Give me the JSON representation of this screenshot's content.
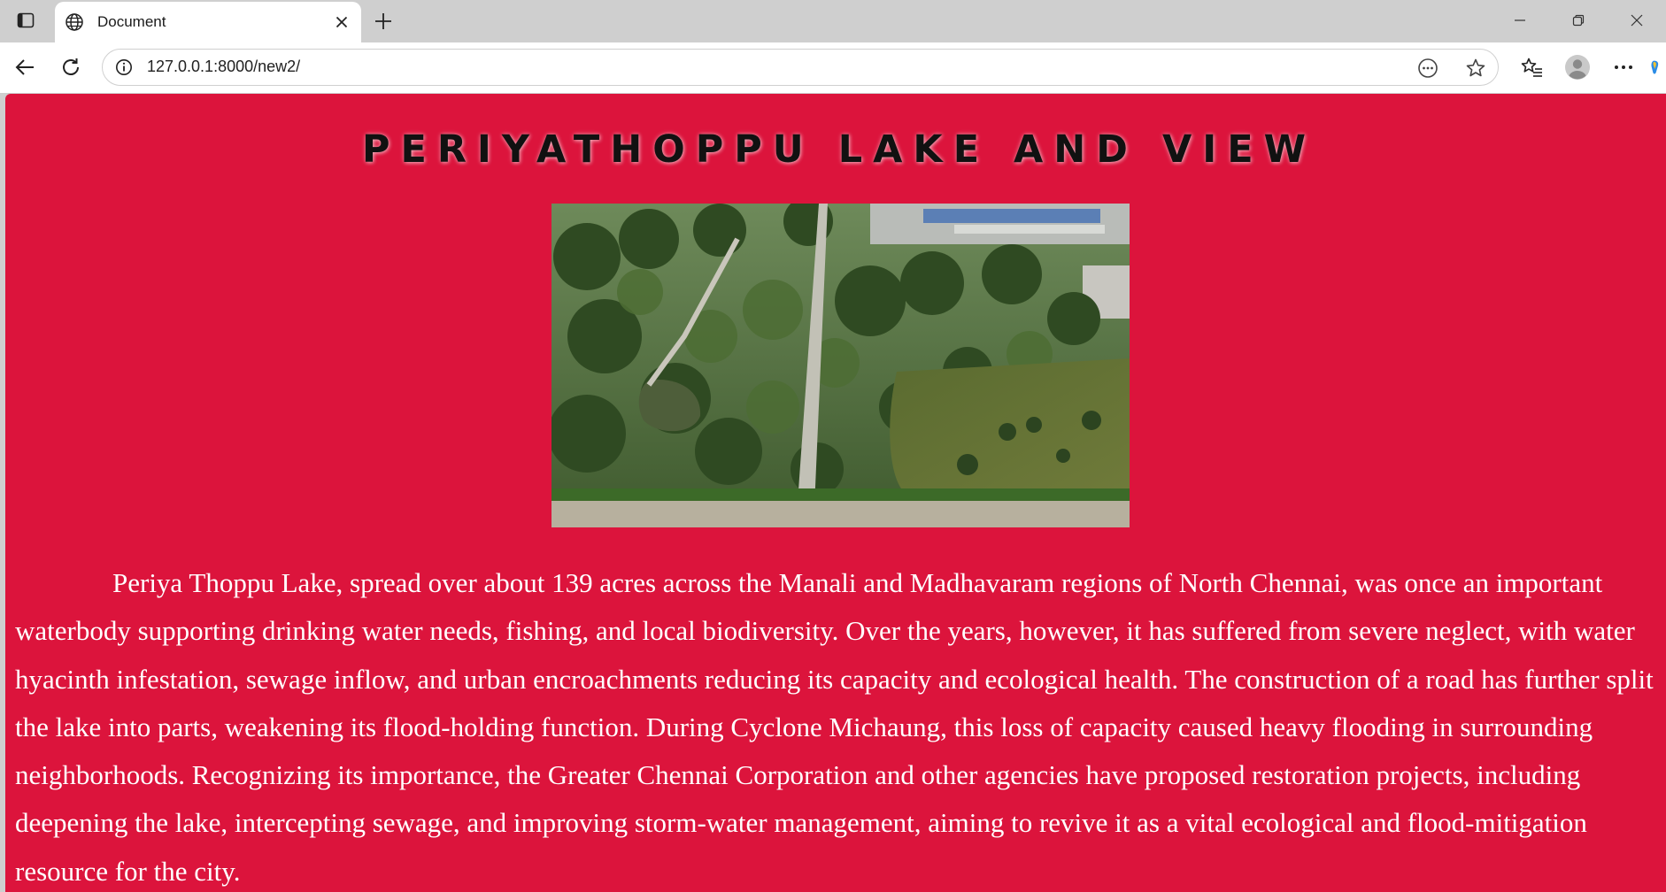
{
  "browser": {
    "tab_title": "Document",
    "url": "127.0.0.1:8000/new2/"
  },
  "page": {
    "heading": "PERIYATHOPPU LAKE AND VIEW",
    "image_alt": "Aerial view of Periyathoppu lake and park",
    "paragraph": "Periya Thoppu Lake, spread over about 139 acres across the Manali and Madhavaram regions of North Chennai, was once an important waterbody supporting drinking water needs, fishing, and local biodiversity. Over the years, however, it has suffered from severe neglect, with water hyacinth infestation, sewage inflow, and urban encroachments reducing its capacity and ecological health. The construction of a road has further split the lake into parts, weakening its flood-holding function. During Cyclone Michaung, this loss of capacity caused heavy flooding in surrounding neighborhoods. Recognizing its importance, the Greater Chennai Corporation and other agencies have proposed restoration projects, including deepening the lake, intercepting sewage, and improving storm-water management, aiming to revive it as a vital ecological and flood-mitigation resource for the city.",
    "background_color": "#dc143c",
    "text_color": "#ffffff"
  }
}
